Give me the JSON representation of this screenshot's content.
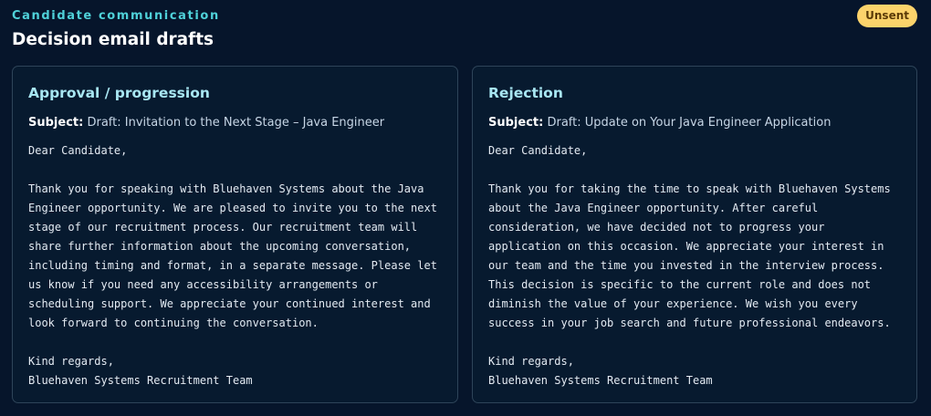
{
  "header": {
    "eyebrow": "Candidate communication",
    "title": "Decision email drafts",
    "status_badge": "Unsent"
  },
  "drafts": [
    {
      "heading": "Approval / progression",
      "subject_label": "Subject:",
      "subject": "Draft: Invitation to the Next Stage – Java Engineer",
      "body": "Dear Candidate,\n\nThank you for speaking with Bluehaven Systems about the Java\nEngineer opportunity. We are pleased to invite you to the next\nstage of our recruitment process. Our recruitment team will\nshare further information about the upcoming conversation,\nincluding timing and format, in a separate message. Please let\nus know if you need any accessibility arrangements or\nscheduling support. We appreciate your continued interest and\nlook forward to continuing the conversation.\n\nKind regards,\nBluehaven Systems Recruitment Team"
    },
    {
      "heading": "Rejection",
      "subject_label": "Subject:",
      "subject": "Draft: Update on Your Java Engineer Application",
      "body": "Dear Candidate,\n\nThank you for taking the time to speak with Bluehaven Systems\nabout the Java Engineer opportunity. After careful\nconsideration, we have decided not to progress your\napplication on this occasion. We appreciate your interest in\nour team and the time you invested in the interview process.\nThis decision is specific to the current role and does not\ndiminish the value of your experience. We wish you every\nsuccess in your job search and future professional endeavors.\n\nKind regards,\nBluehaven Systems Recruitment Team"
    }
  ]
}
